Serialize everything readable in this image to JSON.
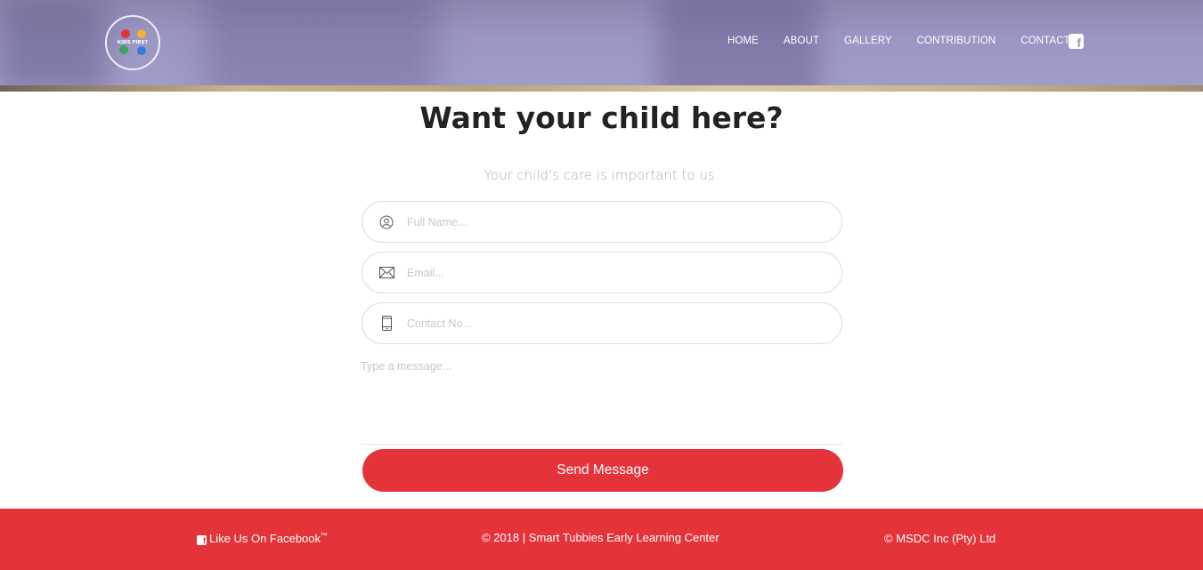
{
  "logo": {
    "alt": "Smart Tubbies Early Learning Centre",
    "inner": "KIDS FIRST"
  },
  "nav": {
    "items": [
      "HOME",
      "ABOUT",
      "GALLERY",
      "CONTRIBUTION",
      "CONTACT"
    ],
    "facebook_icon": "facebook-icon"
  },
  "main": {
    "title": "Want your child here?",
    "subtitle": "Your child's care is important to us.",
    "fields": {
      "name_placeholder": "Full Name...",
      "email_placeholder": "Email...",
      "contact_placeholder": "Contact No...",
      "message_placeholder": "Type a message..."
    },
    "send_label": "Send Message"
  },
  "footer": {
    "like_label": "Like Us On Facebook",
    "tm": "™",
    "copyright": "© 2018 | Smart Tubbies Early Learning Center",
    "credit": "© MSDC Inc (Pty) Ltd"
  },
  "colors": {
    "accent": "#e5333a",
    "header": "#9b96c2"
  }
}
